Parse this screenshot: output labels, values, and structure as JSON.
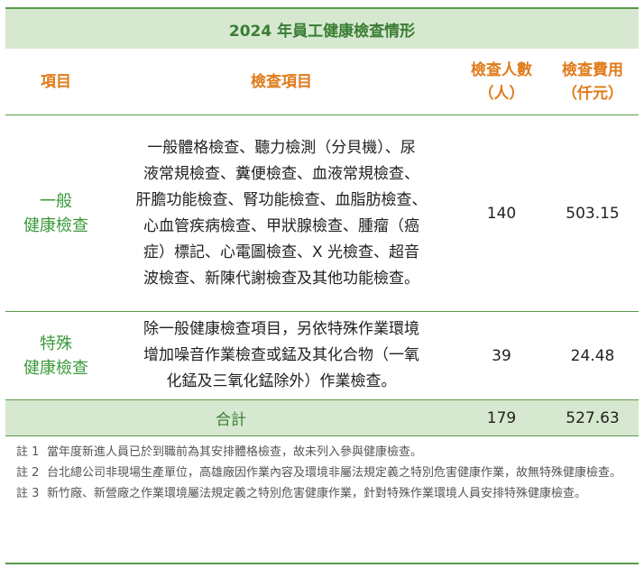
{
  "title": "2024 年員工健康檢查情形",
  "headers": {
    "item": "項目",
    "check_items": "檢查項目",
    "people": "檢查人數\n（人）",
    "cost": "檢查費用\n（仟元）"
  },
  "rows": [
    {
      "category": "一般\n健康檢查",
      "description": "一般體格檢查、聽力檢測（分貝機）、尿\n液常規檢查、糞便檢查、血液常規檢查、\n肝膽功能檢查、腎功能檢查、血脂肪檢查、\n心血管疾病檢查、甲狀腺檢查、腫瘤（癌\n症）標記、心電圖檢查、X 光檢查、超音\n波檢查、新陳代謝檢查及其他功能檢查。",
      "people": "140",
      "cost": "503.15"
    },
    {
      "category": "特殊\n健康檢查",
      "description": "除一般健康檢查項目，另依特殊作業環境\n增加噪音作業檢查或錳及其化合物（一氧\n化錳及三氧化錳除外）作業檢查。",
      "people": "39",
      "cost": "24.48"
    }
  ],
  "total": {
    "label": "合計",
    "people": "179",
    "cost": "527.63"
  },
  "notes": [
    {
      "label": "註 1",
      "text": "當年度新進人員已於到職前為其安排體格檢查，故未列入參與健康檢查。"
    },
    {
      "label": "註 2",
      "text": "台北總公司非現場生產單位，高雄廠因作業內容及環境非屬法規定義之特別危害健康作業，故無特殊健康檢查。"
    },
    {
      "label": "註 3",
      "text": "新竹廠、新營廠之作業環境屬法規定義之特別危害健康作業，針對特殊作業環境人員安排特殊健康檢查。"
    }
  ]
}
